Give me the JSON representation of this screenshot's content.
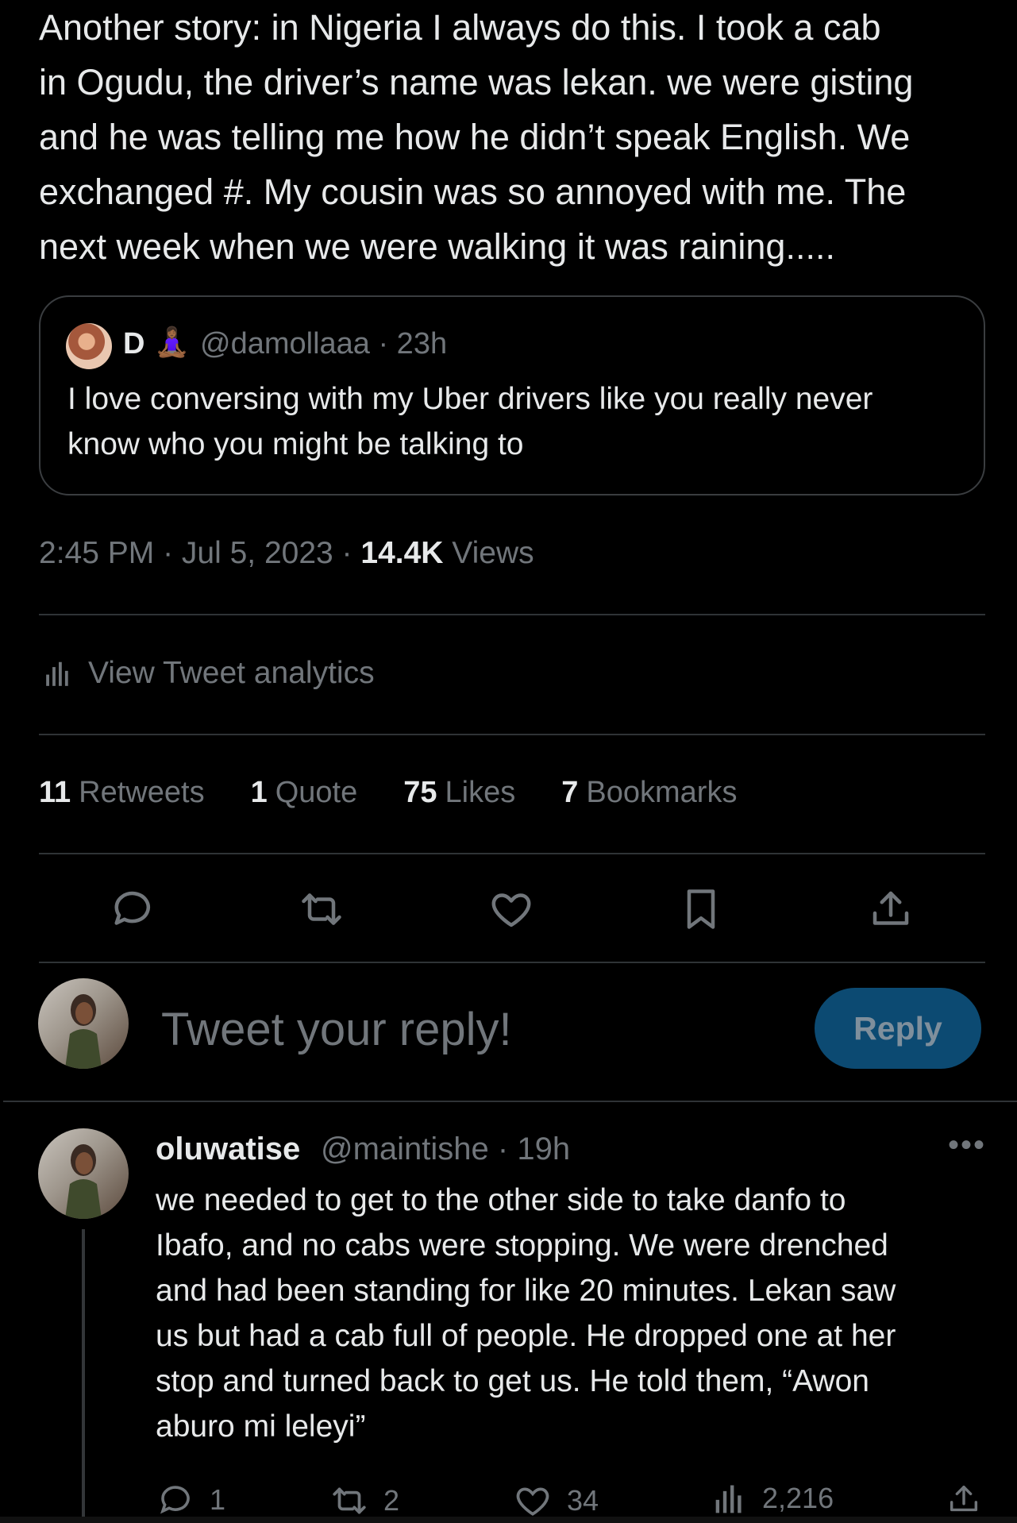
{
  "tweet": {
    "text": "Another story: in Nigeria I always do this. I took a cab\nin Ogudu, the driver’s name was lekan. we were gisting\nand he was telling me how he didn’t speak English. We\nexchanged #. My cousin was so annoyed with me. The\nnext week when we were walking it was raining.....",
    "timestamp": "2:45 PM · Jul 5, 2023 · ",
    "views_count": "14.4K",
    "views_label": " Views"
  },
  "quote": {
    "name": "D",
    "emoji": "🧘🏾‍♀️",
    "meta": "@damollaaa · 23h",
    "text": "I love conversing with my Uber drivers like you really never\nknow who you might be talking to"
  },
  "analytics_label": "View Tweet analytics",
  "stats": {
    "retweets_count": "11",
    "retweets_label": "Retweets",
    "quote_count": "1",
    "quote_label": "Quote",
    "likes_count": "75",
    "likes_label": "Likes",
    "bookmarks_count": "7",
    "bookmarks_label": "Bookmarks"
  },
  "reply_box": {
    "placeholder": "Tweet your reply!",
    "button_label": "Reply"
  },
  "reply": {
    "author": "oluwatise",
    "meta": "@maintishe · 19h",
    "more": "•••",
    "text": "we needed to get to the other side to take danfo to\nIbafo, and no cabs were stopping. We were drenched\nand had been standing for like 20 minutes. Lekan saw\nus but had a cab full of people. He dropped one at her\nstop and turned back to get us. He told them, “Awon\naburo mi leleyi”",
    "replies": "1",
    "retweets": "2",
    "likes": "34",
    "views": "2,216"
  },
  "colors": {
    "background": "#000000",
    "text": "#e7e9ea",
    "muted": "#71767b",
    "border": "#2f3336",
    "reply_button": "#0c4a72"
  },
  "icons": [
    "reply-icon",
    "retweet-icon",
    "like-icon",
    "bookmark-icon",
    "share-icon",
    "analytics-icon",
    "more-icon"
  ]
}
